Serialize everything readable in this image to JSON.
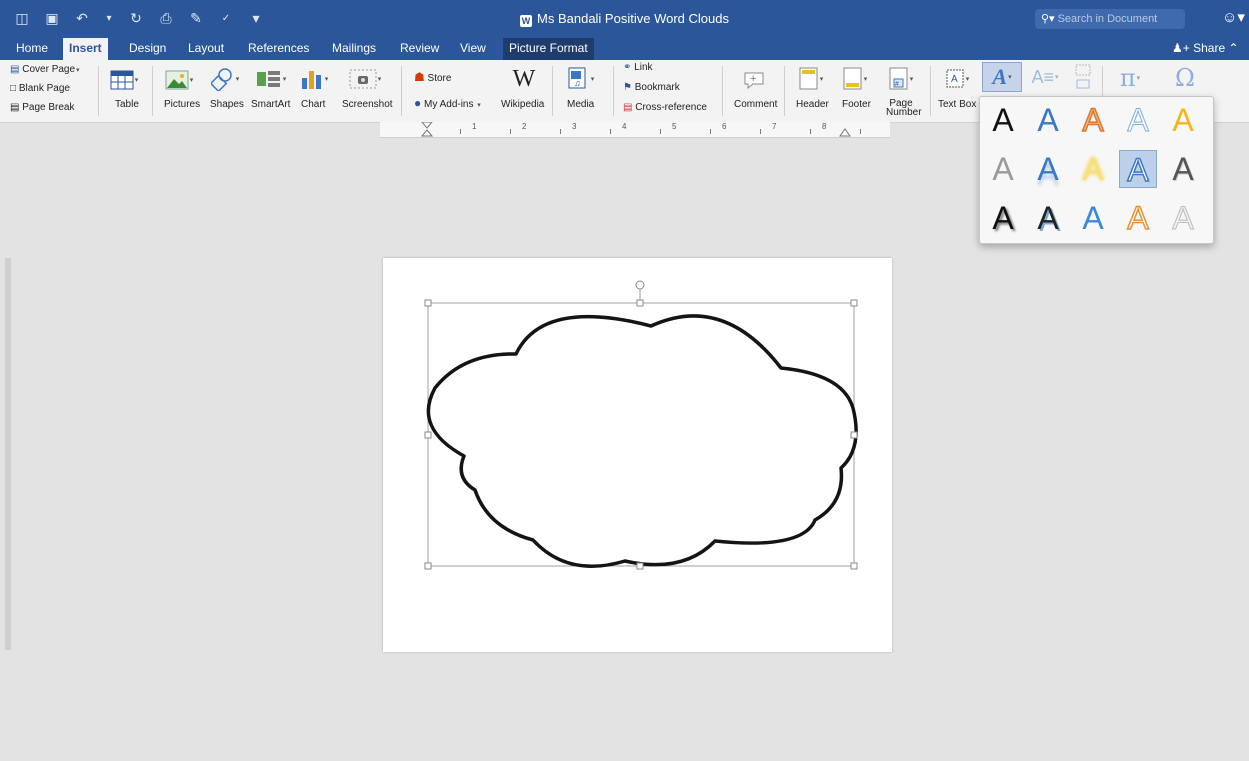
{
  "window": {
    "title": "Ms Bandali Positive Word Clouds"
  },
  "search": {
    "placeholder": "Search in Document"
  },
  "share_label": "Share",
  "tabs": [
    "Home",
    "Insert",
    "Design",
    "Layout",
    "References",
    "Mailings",
    "Review",
    "View",
    "Picture Format"
  ],
  "active_tab": "Insert",
  "ribbon": {
    "pages": {
      "cover": "Cover Page",
      "blank": "Blank Page",
      "break": "Page Break"
    },
    "table": "Table",
    "pictures": "Pictures",
    "shapes": "Shapes",
    "smartart": "SmartArt",
    "chart": "Chart",
    "screenshot": "Screenshot",
    "store": "Store",
    "addins": "My Add-ins",
    "wikipedia": "Wikipedia",
    "media": "Media",
    "link": "Link",
    "bookmark": "Bookmark",
    "crossref": "Cross-reference",
    "comment": "Comment",
    "header": "Header",
    "footer": "Footer",
    "page_number": "Page Number",
    "textbox": "Text Box"
  },
  "ruler": {
    "numbers": [
      "1",
      "2",
      "3",
      "4",
      "5",
      "6",
      "7",
      "8"
    ]
  },
  "colors": {
    "accent": "#2b579a",
    "ribbon_bg": "#f3f3f3",
    "canvas": "#e3e3e3"
  },
  "wordart_styles": [
    {
      "name": "fill-black",
      "glyph": "A"
    },
    {
      "name": "fill-blue",
      "glyph": "A"
    },
    {
      "name": "gradient-orange",
      "glyph": "A"
    },
    {
      "name": "outline-blue",
      "glyph": "A"
    },
    {
      "name": "fill-gold",
      "glyph": "A"
    },
    {
      "name": "fill-gray",
      "glyph": "A"
    },
    {
      "name": "blue-reflection",
      "glyph": "A"
    },
    {
      "name": "gold-glow",
      "glyph": "A"
    },
    {
      "name": "blue-outline-selected",
      "glyph": "A"
    },
    {
      "name": "gray-bevel",
      "glyph": "A"
    },
    {
      "name": "black-shadow",
      "glyph": "A"
    },
    {
      "name": "black-blue-shadow",
      "glyph": "A"
    },
    {
      "name": "blue-gradient",
      "glyph": "A"
    },
    {
      "name": "orange-outline",
      "glyph": "A"
    },
    {
      "name": "white-gray",
      "glyph": "A"
    }
  ],
  "selected_wordart": "blue-outline-selected"
}
